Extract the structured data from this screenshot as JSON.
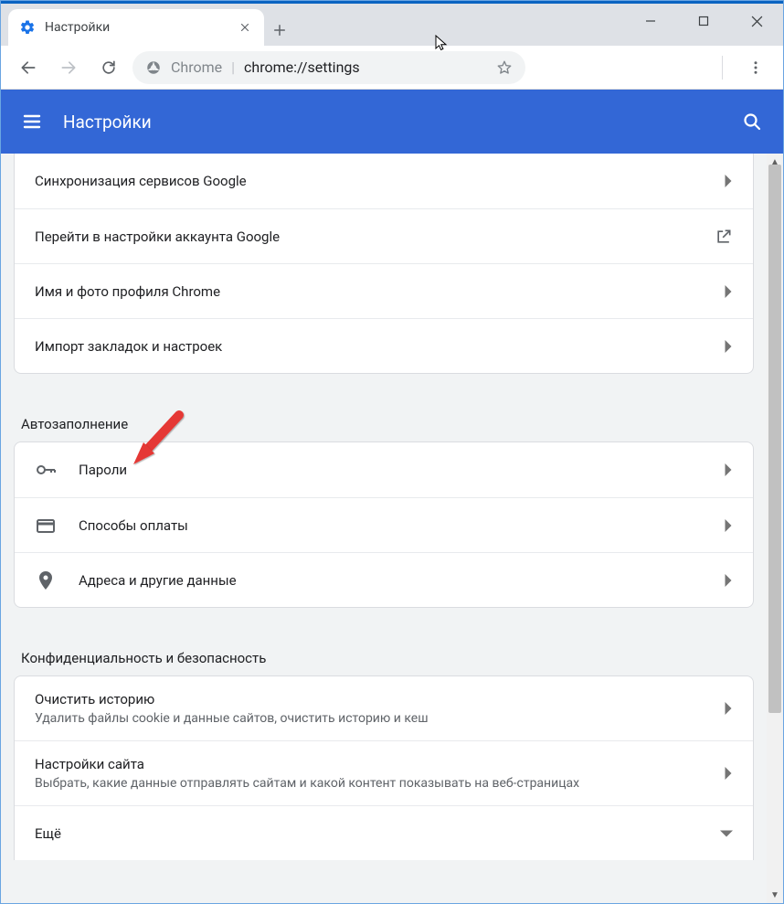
{
  "browser": {
    "tab_title": "Настройки",
    "omnibox_prefix": "Chrome",
    "omnibox_url": "chrome://settings"
  },
  "appbar": {
    "title": "Настройки"
  },
  "section1": {
    "rows": [
      {
        "label": "Синхронизация сервисов Google"
      },
      {
        "label": "Перейти в настройки аккаунта Google"
      },
      {
        "label": "Имя и фото профиля Chrome"
      },
      {
        "label": "Импорт закладок и настроек"
      }
    ]
  },
  "section_autofill": {
    "title": "Автозаполнение",
    "rows": [
      {
        "label": "Пароли"
      },
      {
        "label": "Способы оплаты"
      },
      {
        "label": "Адреса и другие данные"
      }
    ]
  },
  "section_privacy": {
    "title": "Конфиденциальность и безопасность",
    "rows": [
      {
        "label": "Очистить историю",
        "sub": "Удалить файлы cookie и данные сайтов, очистить историю и кеш"
      },
      {
        "label": "Настройки сайта",
        "sub": "Выбрать, какие данные отправлять сайтам и какой контент показывать на веб-страницах"
      },
      {
        "label": "Ещё"
      }
    ]
  }
}
